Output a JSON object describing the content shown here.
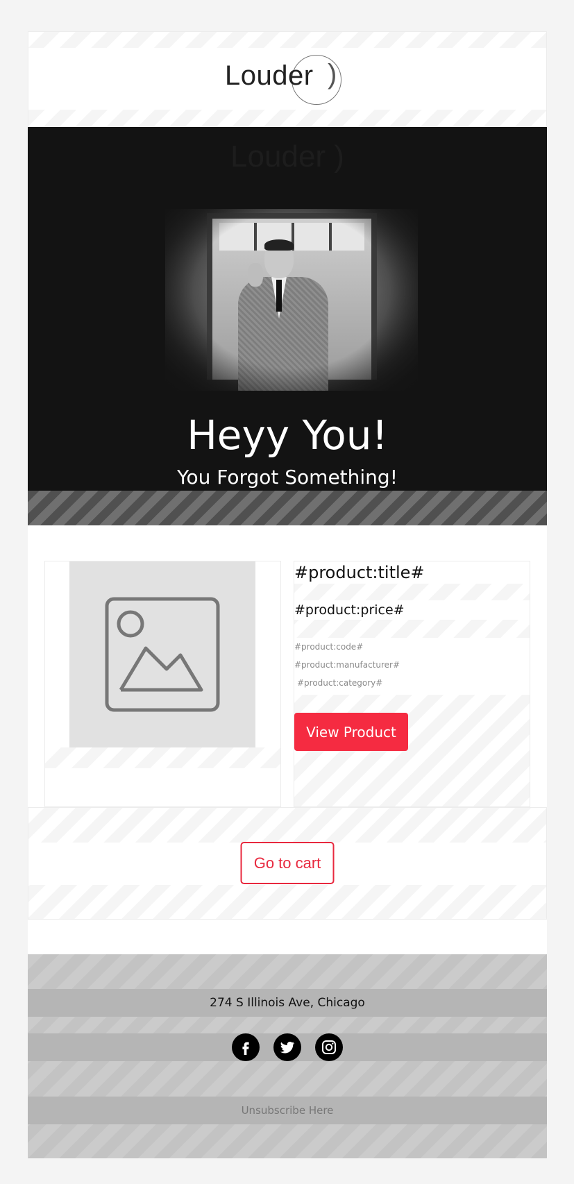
{
  "header": {
    "logo_text": "Louder",
    "logo_paren": ")"
  },
  "hero": {
    "ghost_logo": "Louder )",
    "title": "Heyy You!",
    "subtitle": "You Forgot Something!"
  },
  "product": {
    "title": "#product:title#",
    "price": "#product:price#",
    "code": "#product:code#",
    "manufacturer": "#product:manufacturer#",
    "category": "#product:category#",
    "view_button": "View Product",
    "image_icon": "image-placeholder-icon"
  },
  "cart": {
    "button": "Go to cart"
  },
  "footer": {
    "address": "274 S Illinois Ave, Chicago",
    "social": [
      "facebook-icon",
      "twitter-icon",
      "instagram-icon"
    ],
    "unsubscribe": "Unsubscribe Here"
  },
  "colors": {
    "accent": "#f52b41",
    "hero_bg": "#131313",
    "footer_band": "#b5b5b5"
  }
}
